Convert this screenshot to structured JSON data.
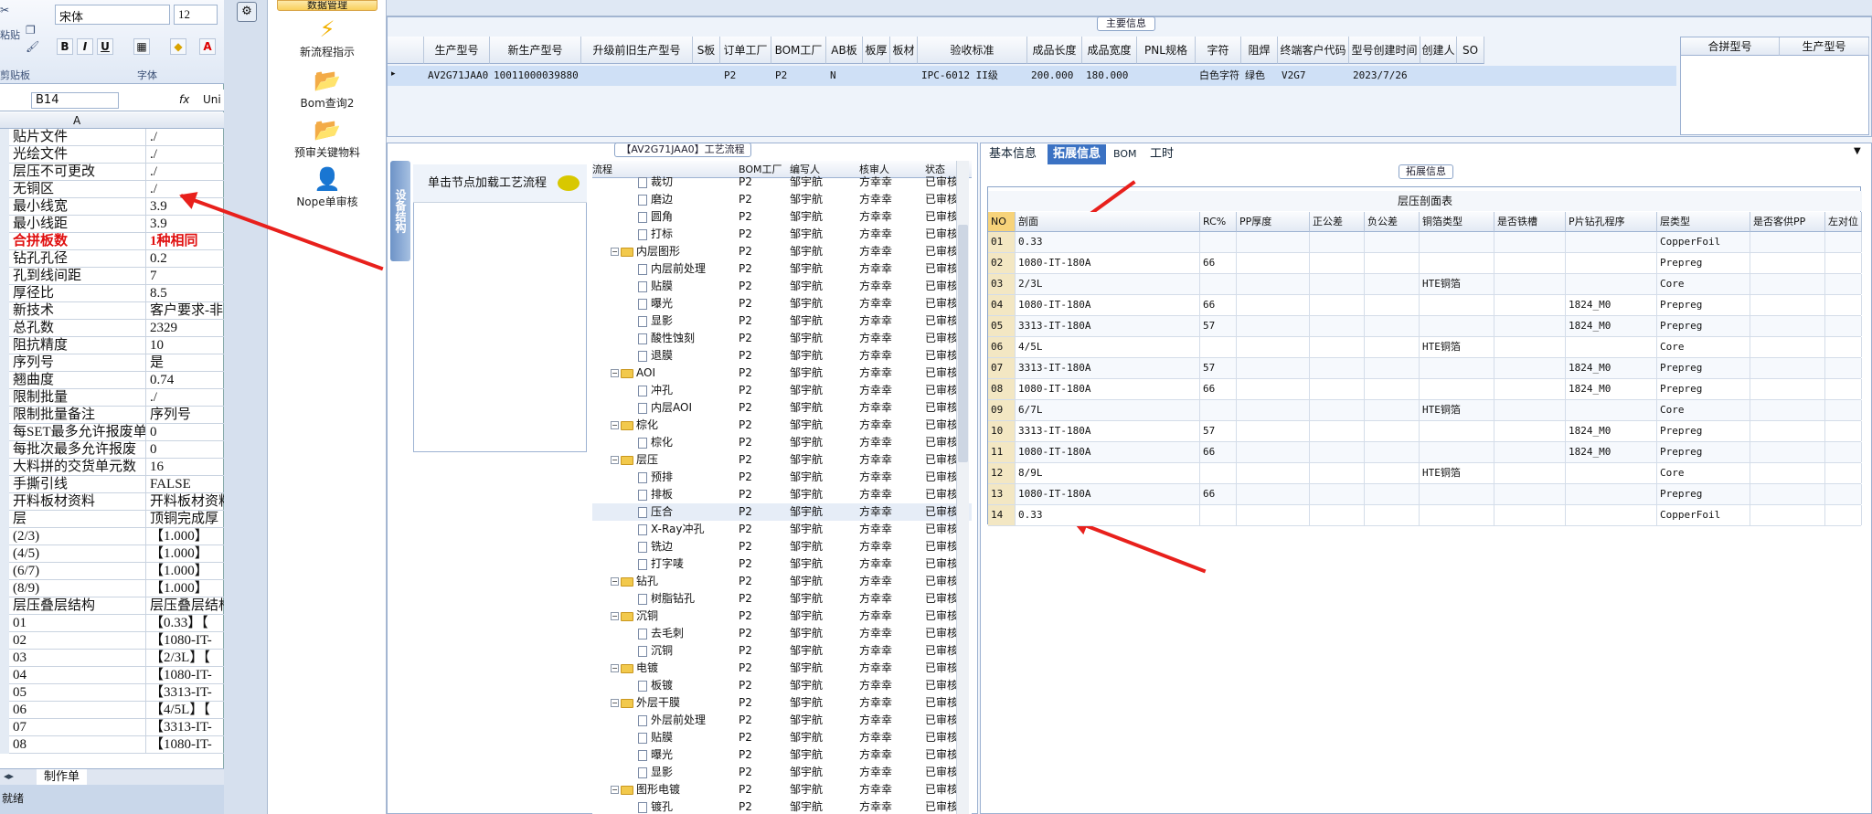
{
  "excel": {
    "font_name": "宋体",
    "font_size": "12",
    "paste_label": "粘贴",
    "clipboard_label": "剪贴板",
    "font_group_label": "字体",
    "cell_ref": "B14",
    "fx": "fx",
    "formula_value": "Uni",
    "col_a": "A",
    "sheet_tab": "制作单",
    "status": "就绪",
    "rows": [
      {
        "a": "贴片文件",
        "b": "./"
      },
      {
        "a": "光绘文件",
        "b": "./"
      },
      {
        "a": "层压不可更改",
        "b": "./"
      },
      {
        "a": "无铜区",
        "b": "./"
      },
      {
        "a": "最小线宽",
        "b": "3.9"
      },
      {
        "a": "最小线距",
        "b": "3.9"
      },
      {
        "a": "合拼板数",
        "b": "1种相同",
        "red": true
      },
      {
        "a": "钻孔孔径",
        "b": "0.2"
      },
      {
        "a": "孔到线间距",
        "b": "7"
      },
      {
        "a": "厚径比",
        "b": "8.5"
      },
      {
        "a": "新技术",
        "b": "客户要求-非"
      },
      {
        "a": "总孔数",
        "b": "2329"
      },
      {
        "a": "阻抗精度",
        "b": "10"
      },
      {
        "a": "序列号",
        "b": "是"
      },
      {
        "a": "翘曲度",
        "b": "0.74"
      },
      {
        "a": "限制批量",
        "b": "./"
      },
      {
        "a": "限制批量备注",
        "b": "序列号"
      },
      {
        "a": "每SET最多允许报废单",
        "b": "0"
      },
      {
        "a": "每批次最多允许报废",
        "b": "0"
      },
      {
        "a": "大料拼的交货单元数",
        "b": "16"
      },
      {
        "a": "手撕引线",
        "b": "FALSE"
      },
      {
        "a": "开料板材资料",
        "b": "开料板材资料"
      },
      {
        "a": "层",
        "b": "顶铜完成厚"
      },
      {
        "a": "(2/3)",
        "b": "【1.000】"
      },
      {
        "a": "(4/5)",
        "b": "【1.000】"
      },
      {
        "a": "(6/7)",
        "b": "【1.000】"
      },
      {
        "a": "(8/9)",
        "b": "【1.000】"
      },
      {
        "a": "层压叠层结构",
        "b": "层压叠层结构"
      },
      {
        "a": "01",
        "b": "【0.33】【"
      },
      {
        "a": "02",
        "b": "【1080-IT-"
      },
      {
        "a": "03",
        "b": "【2/3L】【"
      },
      {
        "a": "04",
        "b": "【1080-IT-"
      },
      {
        "a": "05",
        "b": "【3313-IT-"
      },
      {
        "a": "06",
        "b": "【4/5L】【"
      },
      {
        "a": "07",
        "b": "【3313-IT-"
      },
      {
        "a": "08",
        "b": "【1080-IT-"
      }
    ]
  },
  "menu": {
    "section_title": "数据管理",
    "items": [
      {
        "label": "新流程指示"
      },
      {
        "label": "Bom查询2"
      },
      {
        "label": "预审关键物料"
      },
      {
        "label": "Nope单审核"
      }
    ]
  },
  "main_info": {
    "title": "主要信息",
    "headers": [
      "生产型号",
      "新生产型号",
      "升级前旧生产型号",
      "S板",
      "订单工厂",
      "BOM工厂",
      "AB板",
      "板厚",
      "板材",
      "验收标准",
      "成品长度",
      "成品宽度",
      "PNL规格",
      "字符",
      "阻焊",
      "终端客户代码",
      "型号创建时间",
      "创建人",
      "SO"
    ],
    "row": [
      "AV2G71JAA0",
      "10011000039880",
      "",
      "",
      "P2",
      "P2",
      "N",
      "",
      "",
      "IPC-6012 II级",
      "200.000",
      "180.000",
      "",
      "白色字符",
      "绿色",
      "V2G7",
      "2023/7/26",
      "",
      ""
    ],
    "side_headers": [
      "合拼型号",
      "生产型号"
    ]
  },
  "flow": {
    "title": "【AV2G71JAA0】工艺流程",
    "side_tab": "设备结构",
    "node_hint": "单击节点加载工艺流程",
    "headers": [
      "流程",
      "BOM工厂",
      "编写人",
      "核审人",
      "状态"
    ],
    "rows": [
      {
        "lv": 2,
        "name": "裁切",
        "f": "P2",
        "w": "邹宇航",
        "r": "方幸幸",
        "s": "已审核"
      },
      {
        "lv": 2,
        "name": "磨边",
        "f": "P2",
        "w": "邹宇航",
        "r": "方幸幸",
        "s": "已审核"
      },
      {
        "lv": 2,
        "name": "圆角",
        "f": "P2",
        "w": "邹宇航",
        "r": "方幸幸",
        "s": "已审核"
      },
      {
        "lv": 2,
        "name": "打标",
        "f": "P2",
        "w": "邹宇航",
        "r": "方幸幸",
        "s": "已审核"
      },
      {
        "lv": 1,
        "name": "内层图形",
        "f": "P2",
        "w": "邹宇航",
        "r": "方幸幸",
        "s": "已审核"
      },
      {
        "lv": 2,
        "name": "内层前处理",
        "f": "P2",
        "w": "邹宇航",
        "r": "方幸幸",
        "s": "已审核"
      },
      {
        "lv": 2,
        "name": "贴膜",
        "f": "P2",
        "w": "邹宇航",
        "r": "方幸幸",
        "s": "已审核"
      },
      {
        "lv": 2,
        "name": "曝光",
        "f": "P2",
        "w": "邹宇航",
        "r": "方幸幸",
        "s": "已审核"
      },
      {
        "lv": 2,
        "name": "显影",
        "f": "P2",
        "w": "邹宇航",
        "r": "方幸幸",
        "s": "已审核"
      },
      {
        "lv": 2,
        "name": "酸性蚀刻",
        "f": "P2",
        "w": "邹宇航",
        "r": "方幸幸",
        "s": "已审核"
      },
      {
        "lv": 2,
        "name": "退膜",
        "f": "P2",
        "w": "邹宇航",
        "r": "方幸幸",
        "s": "已审核"
      },
      {
        "lv": 1,
        "name": "AOI",
        "f": "P2",
        "w": "邹宇航",
        "r": "方幸幸",
        "s": "已审核"
      },
      {
        "lv": 2,
        "name": "冲孔",
        "f": "P2",
        "w": "邹宇航",
        "r": "方幸幸",
        "s": "已审核"
      },
      {
        "lv": 2,
        "name": "内层AOI",
        "f": "P2",
        "w": "邹宇航",
        "r": "方幸幸",
        "s": "已审核"
      },
      {
        "lv": 1,
        "name": "棕化",
        "f": "P2",
        "w": "邹宇航",
        "r": "方幸幸",
        "s": "已审核"
      },
      {
        "lv": 2,
        "name": "棕化",
        "f": "P2",
        "w": "邹宇航",
        "r": "方幸幸",
        "s": "已审核"
      },
      {
        "lv": 1,
        "name": "层压",
        "f": "P2",
        "w": "邹宇航",
        "r": "方幸幸",
        "s": "已审核"
      },
      {
        "lv": 2,
        "name": "预排",
        "f": "P2",
        "w": "邹宇航",
        "r": "方幸幸",
        "s": "已审核"
      },
      {
        "lv": 2,
        "name": "排板",
        "f": "P2",
        "w": "邹宇航",
        "r": "方幸幸",
        "s": "已审核"
      },
      {
        "lv": 2,
        "name": "压合",
        "f": "P2",
        "w": "邹宇航",
        "r": "方幸幸",
        "s": "已审核",
        "sel": true
      },
      {
        "lv": 2,
        "name": "X-Ray冲孔",
        "f": "P2",
        "w": "邹宇航",
        "r": "方幸幸",
        "s": "已审核"
      },
      {
        "lv": 2,
        "name": "铣边",
        "f": "P2",
        "w": "邹宇航",
        "r": "方幸幸",
        "s": "已审核"
      },
      {
        "lv": 2,
        "name": "打字唛",
        "f": "P2",
        "w": "邹宇航",
        "r": "方幸幸",
        "s": "已审核"
      },
      {
        "lv": 1,
        "name": "钻孔",
        "f": "P2",
        "w": "邹宇航",
        "r": "方幸幸",
        "s": "已审核"
      },
      {
        "lv": 2,
        "name": "树脂钻孔",
        "f": "P2",
        "w": "邹宇航",
        "r": "方幸幸",
        "s": "已审核"
      },
      {
        "lv": 1,
        "name": "沉铜",
        "f": "P2",
        "w": "邹宇航",
        "r": "方幸幸",
        "s": "已审核"
      },
      {
        "lv": 2,
        "name": "去毛刺",
        "f": "P2",
        "w": "邹宇航",
        "r": "方幸幸",
        "s": "已审核"
      },
      {
        "lv": 2,
        "name": "沉铜",
        "f": "P2",
        "w": "邹宇航",
        "r": "方幸幸",
        "s": "已审核"
      },
      {
        "lv": 1,
        "name": "电镀",
        "f": "P2",
        "w": "邹宇航",
        "r": "方幸幸",
        "s": "已审核"
      },
      {
        "lv": 2,
        "name": "板镀",
        "f": "P2",
        "w": "邹宇航",
        "r": "方幸幸",
        "s": "已审核"
      },
      {
        "lv": 1,
        "name": "外层干膜",
        "f": "P2",
        "w": "邹宇航",
        "r": "方幸幸",
        "s": "已审核"
      },
      {
        "lv": 2,
        "name": "外层前处理",
        "f": "P2",
        "w": "邹宇航",
        "r": "方幸幸",
        "s": "已审核"
      },
      {
        "lv": 2,
        "name": "贴膜",
        "f": "P2",
        "w": "邹宇航",
        "r": "方幸幸",
        "s": "已审核"
      },
      {
        "lv": 2,
        "name": "曝光",
        "f": "P2",
        "w": "邹宇航",
        "r": "方幸幸",
        "s": "已审核"
      },
      {
        "lv": 2,
        "name": "显影",
        "f": "P2",
        "w": "邹宇航",
        "r": "方幸幸",
        "s": "已审核"
      },
      {
        "lv": 1,
        "name": "图形电镀",
        "f": "P2",
        "w": "邹宇航",
        "r": "方幸幸",
        "s": "已审核"
      },
      {
        "lv": 2,
        "name": "镀孔",
        "f": "P2",
        "w": "邹宇航",
        "r": "方幸幸",
        "s": "已审核"
      }
    ]
  },
  "detail": {
    "tabs": [
      "基本信息",
      "拓展信息",
      "BOM",
      "工时"
    ],
    "active_tab": 1,
    "group_title": "拓展信息",
    "table_title": "层压剖面表",
    "headers": [
      "NO",
      "剖面",
      "RC%",
      "PP厚度",
      "正公差",
      "负公差",
      "铜箔类型",
      "是否铁槽",
      "P片钻孔程序",
      "层类型",
      "是否客供PP",
      "左对位"
    ],
    "rows": [
      [
        "01",
        "0.33",
        "",
        "",
        "",
        "",
        "",
        "",
        "",
        "CopperFoil",
        "",
        ""
      ],
      [
        "02",
        "1080-IT-180A",
        "66",
        "",
        "",
        "",
        "",
        "",
        "",
        "Prepreg",
        "",
        ""
      ],
      [
        "03",
        "2/3L",
        "",
        "",
        "",
        "",
        "HTE铜箔",
        "",
        "",
        "Core",
        "",
        ""
      ],
      [
        "04",
        "1080-IT-180A",
        "66",
        "",
        "",
        "",
        "",
        "",
        "1824_M0",
        "Prepreg",
        "",
        ""
      ],
      [
        "05",
        "3313-IT-180A",
        "57",
        "",
        "",
        "",
        "",
        "",
        "1824_M0",
        "Prepreg",
        "",
        ""
      ],
      [
        "06",
        "4/5L",
        "",
        "",
        "",
        "",
        "HTE铜箔",
        "",
        "",
        "Core",
        "",
        ""
      ],
      [
        "07",
        "3313-IT-180A",
        "57",
        "",
        "",
        "",
        "",
        "",
        "1824_M0",
        "Prepreg",
        "",
        ""
      ],
      [
        "08",
        "1080-IT-180A",
        "66",
        "",
        "",
        "",
        "",
        "",
        "1824_M0",
        "Prepreg",
        "",
        ""
      ],
      [
        "09",
        "6/7L",
        "",
        "",
        "",
        "",
        "HTE铜箔",
        "",
        "",
        "Core",
        "",
        ""
      ],
      [
        "10",
        "3313-IT-180A",
        "57",
        "",
        "",
        "",
        "",
        "",
        "1824_M0",
        "Prepreg",
        "",
        ""
      ],
      [
        "11",
        "1080-IT-180A",
        "66",
        "",
        "",
        "",
        "",
        "",
        "1824_M0",
        "Prepreg",
        "",
        ""
      ],
      [
        "12",
        "8/9L",
        "",
        "",
        "",
        "",
        "HTE铜箔",
        "",
        "",
        "Core",
        "",
        ""
      ],
      [
        "13",
        "1080-IT-180A",
        "66",
        "",
        "",
        "",
        "",
        "",
        "",
        "Prepreg",
        "",
        ""
      ],
      [
        "14",
        "0.33",
        "",
        "",
        "",
        "",
        "",
        "",
        "",
        "CopperFoil",
        "",
        ""
      ]
    ]
  },
  "colors": {
    "accent": "#3b72c3",
    "annotation": "#e8201c",
    "selected_row": "#cfe0f6"
  }
}
